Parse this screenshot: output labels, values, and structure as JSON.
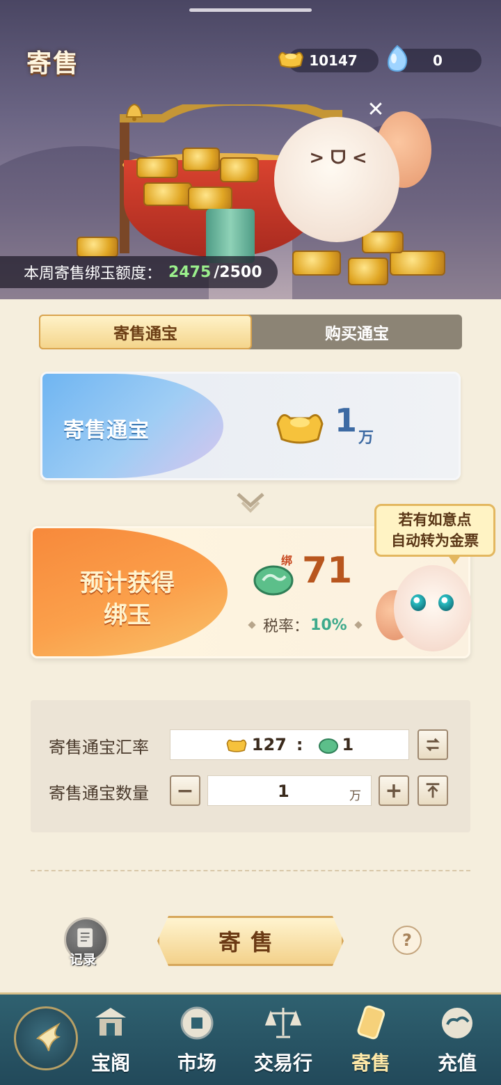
{
  "page": {
    "title": "寄售"
  },
  "currency": {
    "gold": "10147",
    "jade": "0"
  },
  "banner": {
    "quota_label": "本周寄售绑玉额度：",
    "quota_used": "2475",
    "quota_total": "/2500",
    "close": "✕"
  },
  "tabs": [
    {
      "label": "寄售通宝",
      "active": true
    },
    {
      "label": "购买通宝",
      "active": false
    }
  ],
  "sell_card": {
    "label": "寄售通宝",
    "amount": "1",
    "unit": "万"
  },
  "get_card": {
    "label_line1": "预计获得",
    "label_line2": "绑玉",
    "bind_mark": "绑",
    "amount": "71",
    "tax_label": "税率：",
    "tax_value": "10%"
  },
  "tip_bubble": {
    "line1": "若有如意点",
    "line2": "自动转为金票"
  },
  "form": {
    "rate_label": "寄售通宝汇率",
    "rate_gold": "127",
    "rate_sep": ":",
    "rate_jade": "1",
    "qty_label": "寄售通宝数量",
    "qty_value": "1",
    "qty_unit": "万",
    "minus": "−",
    "plus": "+"
  },
  "actions": {
    "record_label": "记录",
    "sell_label": "寄售",
    "help": "?"
  },
  "nav": [
    {
      "label": "宝阁",
      "icon": "pavilion-icon",
      "active": false
    },
    {
      "label": "市场",
      "icon": "coin-icon",
      "active": false
    },
    {
      "label": "交易行",
      "icon": "scale-icon",
      "active": false
    },
    {
      "label": "寄售",
      "icon": "scroll-icon",
      "active": true
    },
    {
      "label": "充值",
      "icon": "cloud-icon",
      "active": false
    }
  ],
  "colors": {
    "accent_gold": "#f3d18a",
    "tax_green": "#3eaa8c",
    "quota_green": "#9bf08c",
    "nav_bg": "#2f6170"
  }
}
